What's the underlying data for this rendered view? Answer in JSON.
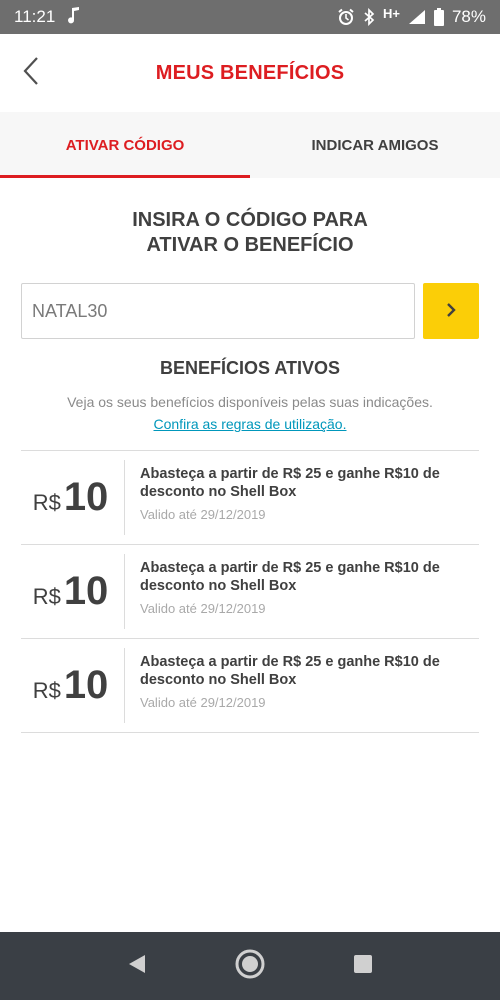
{
  "status_bar": {
    "time": "11:21",
    "network": "H+",
    "battery": "78%"
  },
  "header": {
    "title": "MEUS BENEFÍCIOS"
  },
  "tabs": [
    {
      "label": "ATIVAR CÓDIGO",
      "active": true
    },
    {
      "label": "INDICAR AMIGOS",
      "active": false
    }
  ],
  "activate": {
    "heading_line1": "INSIRA O CÓDIGO PARA",
    "heading_line2": "ATIVAR O BENEFÍCIO",
    "code_value": "NATAL30"
  },
  "benefits": {
    "heading": "BENEFÍCIOS ATIVOS",
    "subtitle": "Veja os seus benefícios disponíveis pelas suas indicações.",
    "rules_link": "Confira as regras de utilização.",
    "items": [
      {
        "currency": "R$",
        "value": "10",
        "description": "Abasteça a partir de R$ 25 e ganhe R$10 de desconto no Shell Box",
        "valid": "Valido até 29/12/2019"
      },
      {
        "currency": "R$",
        "value": "10",
        "description": "Abasteça a partir de R$ 25 e ganhe R$10 de desconto no Shell Box",
        "valid": "Valido até 29/12/2019"
      },
      {
        "currency": "R$",
        "value": "10",
        "description": "Abasteça a partir de R$ 25 e ganhe R$10 de desconto no Shell Box",
        "valid": "Valido até 29/12/2019"
      }
    ]
  },
  "colors": {
    "brand_red": "#dd1d21",
    "brand_yellow": "#fbce07",
    "link_blue": "#0097bb",
    "status_bar": "#6e6e6e",
    "nav_bar": "#3a3f45"
  },
  "icons": {
    "back": "chevron-left-icon",
    "submit": "chevron-right-icon",
    "music": "music-note-icon",
    "alarm": "alarm-icon",
    "bluetooth": "bluetooth-icon",
    "signal": "signal-icon",
    "battery": "battery-icon",
    "nav_back": "triangle-back-icon",
    "nav_home": "circle-home-icon",
    "nav_recents": "square-recents-icon"
  }
}
